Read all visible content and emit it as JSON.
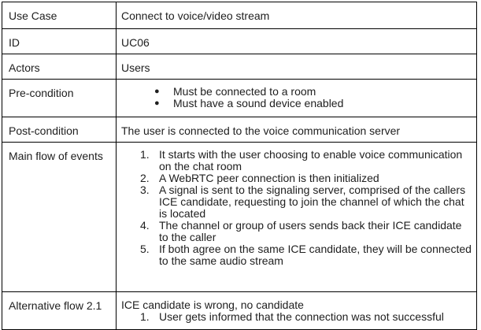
{
  "rows": [
    {
      "label": "Use Case",
      "value": "Connect to voice/video stream"
    },
    {
      "label": "ID",
      "value": "UC06"
    },
    {
      "label": "Actors",
      "value": "Users"
    },
    {
      "label": "Pre-condition",
      "items": [
        "Must be connected to a room",
        "Must have a sound device enabled"
      ]
    },
    {
      "label": "Post-condition",
      "value": "The user is connected to the voice communication server"
    },
    {
      "label": "Main flow of events",
      "steps": [
        "It starts with the user choosing to enable voice communication on the chat room",
        "A WebRTC peer connection is then initialized",
        "A signal is sent to the signaling server, comprised of the callers ICE candidate, requesting to join the channel of which the chat is located",
        "The channel or group of users sends back their ICE candidate to the caller",
        "If both agree on the same ICE candidate, they will be connected to the same audio stream"
      ]
    },
    {
      "label": "Alternative flow 2.1",
      "value": "ICE candidate is wrong, no candidate",
      "steps": [
        "User gets informed that the connection was not successful"
      ]
    }
  ],
  "markers": {
    "bullet": "●",
    "n1": "1.",
    "n2": "2.",
    "n3": "3.",
    "n4": "4.",
    "n5": "5."
  }
}
